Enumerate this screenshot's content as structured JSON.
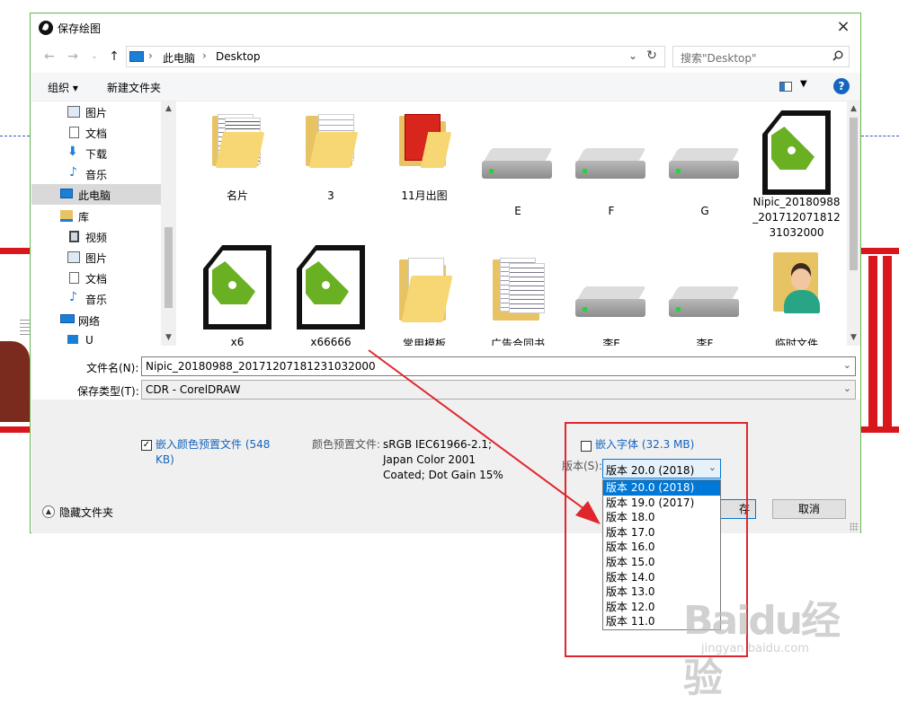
{
  "window": {
    "title": "保存绘图",
    "close": "×"
  },
  "address": {
    "segments": [
      "此电脑",
      "Desktop"
    ],
    "search_placeholder": "搜索\"Desktop\""
  },
  "toolbar": {
    "organize": "组织 ▾",
    "new_folder": "新建文件夹",
    "help": "?"
  },
  "sidebar": {
    "items": [
      {
        "label": "图片",
        "icon": "pictures-icon"
      },
      {
        "label": "文档",
        "icon": "documents-icon"
      },
      {
        "label": "下载",
        "icon": "download-icon"
      },
      {
        "label": "音乐",
        "icon": "music-icon"
      },
      {
        "label": "此电脑",
        "icon": "pc-icon",
        "selected": true
      },
      {
        "label": "库",
        "icon": "library-icon"
      },
      {
        "label": "视频",
        "icon": "videos-icon"
      },
      {
        "label": "图片",
        "icon": "pictures-icon"
      },
      {
        "label": "文档",
        "icon": "documents-icon"
      },
      {
        "label": "音乐",
        "icon": "music-icon"
      },
      {
        "label": "网络",
        "icon": "network-icon"
      },
      {
        "label": "U",
        "icon": "usb-icon"
      }
    ]
  },
  "files": [
    {
      "label": "名片",
      "type": "folder"
    },
    {
      "label": "3",
      "type": "folder"
    },
    {
      "label": "11月出图",
      "type": "folder"
    },
    {
      "label": "E",
      "type": "drive"
    },
    {
      "label": "F",
      "type": "drive"
    },
    {
      "label": "G",
      "type": "drive"
    },
    {
      "label": "Nipic_20180988\n_2017120718\n12\n31032000",
      "type": "cdr"
    },
    {
      "label": "x6",
      "type": "cdr"
    },
    {
      "label": "x66666",
      "type": "cdr"
    },
    {
      "label": "常用模板",
      "type": "folder"
    },
    {
      "label": "广告合同书",
      "type": "folder"
    },
    {
      "label": "李E",
      "type": "drive"
    },
    {
      "label": "李F",
      "type": "drive"
    },
    {
      "label": "临时文件",
      "type": "person-folder"
    }
  ],
  "form": {
    "filename_label": "文件名(N):",
    "filename_value": "Nipic_20180988_20171207181231032000",
    "filetype_label": "保存类型(T):",
    "filetype_value": "CDR - CorelDRAW"
  },
  "options": {
    "embed_color_label": "嵌入颜色预置文件 (548\nKB)",
    "color_profile_label": "颜色预置文件:",
    "color_profile_value": "sRGB IEC61966-2.1;\nJapan Color 2001\nCoated; Dot Gain 15%",
    "embed_fonts_label": "嵌入字体 (32.3 MB)",
    "version_label": "版本(S):",
    "version_value": "版本 20.0 (2018)"
  },
  "version_options": [
    "版本 20.0 (2018)",
    "版本 19.0 (2017)",
    "版本 18.0",
    "版本 17.0",
    "版本 16.0",
    "版本 15.0",
    "版本 14.0",
    "版本 13.0",
    "版本 12.0",
    "版本 11.0"
  ],
  "buttons": {
    "save": "存",
    "cancel": "取消",
    "hide_folders": "隐藏文件夹"
  },
  "watermark": {
    "brand": "Baidu经验",
    "url": "jingyan.baidu.com"
  },
  "colors": {
    "accent": "#0078d7",
    "annotation": "#e0262d",
    "dialog_border": "#65b64b"
  }
}
